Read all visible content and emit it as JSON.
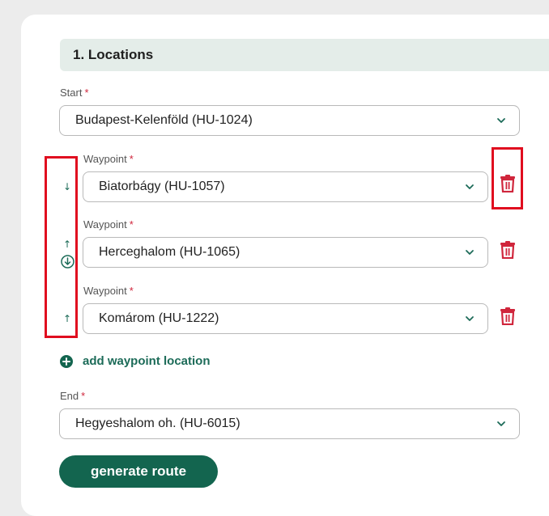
{
  "section": {
    "title": "1. Locations"
  },
  "required_marker": "*",
  "start": {
    "label": "Start",
    "value": "Budapest-Kelenföld (HU-1024)"
  },
  "waypoints": [
    {
      "label": "Waypoint",
      "value": "Biatorbágy (HU-1057)",
      "arrows": [
        "↓"
      ]
    },
    {
      "label": "Waypoint",
      "value": "Herceghalom (HU-1065)",
      "arrows": [
        "↑"
      ]
    },
    {
      "label": "Waypoint",
      "value": "Komárom (HU-1222)",
      "arrows": [
        "↑"
      ]
    }
  ],
  "add_waypoint": {
    "label": "add waypoint location",
    "icon": "plus-circle-icon"
  },
  "end": {
    "label": "End",
    "value": "Hegyeshalom oh. (HU-6015)"
  },
  "generate_button": {
    "label": "generate route"
  },
  "colors": {
    "accent": "#13654f",
    "accent_text": "#1c6b58",
    "danger": "#d0263c",
    "highlight": "#e00d1f",
    "header_bg": "#e4ede9"
  }
}
